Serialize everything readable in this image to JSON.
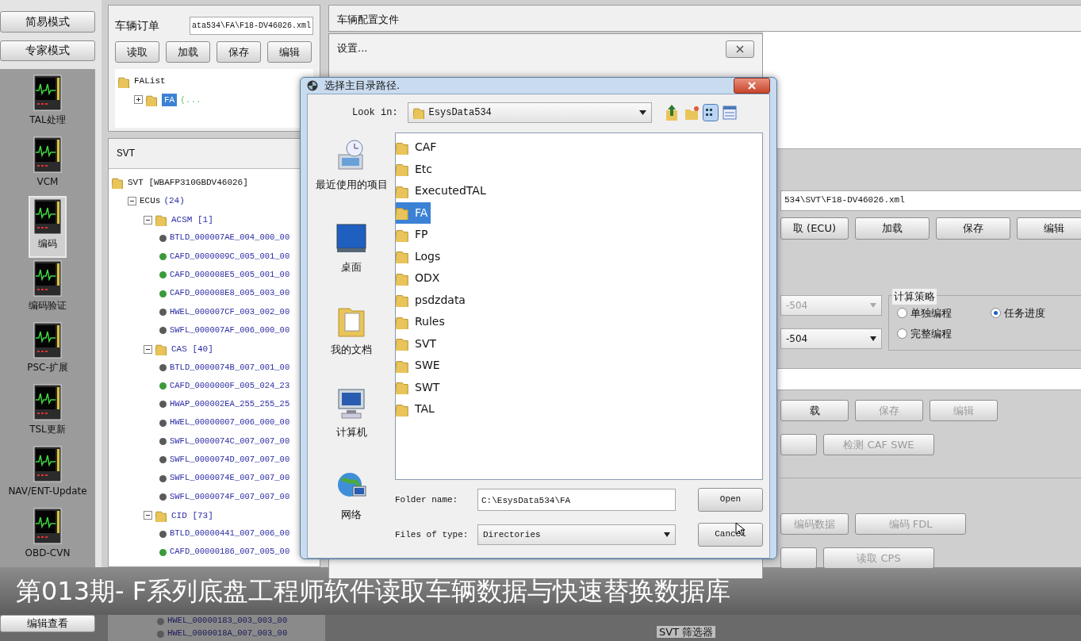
{
  "sidebar": {
    "mode_buttons": [
      {
        "label": "简易模式"
      },
      {
        "label": "专家模式"
      }
    ],
    "items": [
      {
        "label": "TAL处理",
        "selected": false
      },
      {
        "label": "VCM",
        "selected": false
      },
      {
        "label": "编码",
        "selected": true
      },
      {
        "label": "编码验证",
        "selected": false
      },
      {
        "label": "PSC-扩展",
        "selected": false
      },
      {
        "label": "TSL更新",
        "selected": false
      },
      {
        "label": "NAV/ENT-Update",
        "selected": false
      },
      {
        "label": "OBD-CVN",
        "selected": false
      }
    ],
    "bottom_button": "编辑查看"
  },
  "order_panel": {
    "title": "车辆订单",
    "path": "ata534\\FA\\F18-DV46026.xml",
    "buttons": [
      "读取",
      "加载",
      "保存",
      "编辑"
    ],
    "tree": [
      {
        "label": "FAList",
        "kind": "root",
        "selected": false,
        "children": [
          {
            "label": "FA",
            "kind": "folder",
            "expanded": false,
            "selected": true,
            "note": "(..."
          }
        ]
      }
    ]
  },
  "svt_panel": {
    "title": "SVT",
    "tree": [
      {
        "label": "SVT [WBAFP310GBDV46026]",
        "kind": "root",
        "children": [
          {
            "label": "ECUs",
            "count": "(24)",
            "kind": "group",
            "expanded": true,
            "children": [
              {
                "label": "ACSM [1]",
                "kind": "folder",
                "expanded": true,
                "children": [
                  {
                    "label": "BTLD_000007AE_004_000_00",
                    "kind": "leaf",
                    "color": "#5a5a5a"
                  },
                  {
                    "label": "CAFD_0000009C_005_001_00",
                    "kind": "leaf",
                    "color": "#3a9a3a"
                  },
                  {
                    "label": "CAFD_000008E5_005_001_00",
                    "kind": "leaf",
                    "color": "#3a9a3a"
                  },
                  {
                    "label": "CAFD_000008E8_005_003_00",
                    "kind": "leaf",
                    "color": "#3a9a3a"
                  },
                  {
                    "label": "HWEL_000007CF_003_002_00",
                    "kind": "leaf",
                    "color": "#5a5a5a"
                  },
                  {
                    "label": "SWFL_000007AF_006_000_00",
                    "kind": "leaf",
                    "color": "#5a5a5a"
                  }
                ]
              },
              {
                "label": "CAS [40]",
                "kind": "folder",
                "expanded": true,
                "children": [
                  {
                    "label": "BTLD_0000074B_007_001_00",
                    "kind": "leaf",
                    "color": "#5a5a5a"
                  },
                  {
                    "label": "CAFD_0000000F_005_024_23",
                    "kind": "leaf",
                    "color": "#3a9a3a"
                  },
                  {
                    "label": "HWAP_000002EA_255_255_25",
                    "kind": "leaf",
                    "color": "#5a5a5a"
                  },
                  {
                    "label": "HWEL_00000007_006_000_00",
                    "kind": "leaf",
                    "color": "#5a5a5a"
                  },
                  {
                    "label": "SWFL_0000074C_007_007_00",
                    "kind": "leaf",
                    "color": "#5a5a5a"
                  },
                  {
                    "label": "SWFL_0000074D_007_007_00",
                    "kind": "leaf",
                    "color": "#5a5a5a"
                  },
                  {
                    "label": "SWFL_0000074E_007_007_00",
                    "kind": "leaf",
                    "color": "#5a5a5a"
                  },
                  {
                    "label": "SWFL_0000074F_007_007_00",
                    "kind": "leaf",
                    "color": "#5a5a5a"
                  }
                ]
              },
              {
                "label": "CID [73]",
                "kind": "folder",
                "expanded": true,
                "children": [
                  {
                    "label": "BTLD_00000441_007_006_00",
                    "kind": "leaf",
                    "color": "#5a5a5a"
                  },
                  {
                    "label": "CAFD_00000186_007_005_00",
                    "kind": "leaf",
                    "color": "#3a9a3a"
                  }
                ]
              }
            ]
          }
        ]
      }
    ],
    "tree_continued": [
      {
        "label": "HWEL_00000183_003_003_00",
        "color": "#5a5a5a"
      },
      {
        "label": "HWEL_0000018A_007_003_00",
        "color": "#5a5a5a"
      }
    ]
  },
  "config_panel": {
    "title": "车辆配置文件",
    "settings_window": {
      "title": "设置..."
    },
    "path": "534\\SVT\\F18-DV46026.xml",
    "buttons": [
      "取 (ECU)",
      "加载",
      "保存",
      "编辑"
    ],
    "combos": [
      {
        "value": "-504",
        "disabled": true
      },
      {
        "value": "-504",
        "disabled": false
      }
    ],
    "strategy": {
      "title": "计算策略",
      "options": [
        {
          "label": "单独编程",
          "selected": false
        },
        {
          "label": "任务进度",
          "selected": true
        },
        {
          "label": "完整编程",
          "selected": false
        }
      ]
    },
    "button_groups": [
      {
        "rows": [
          [
            {
              "label": "载",
              "disabled": false
            },
            {
              "label": "保存",
              "disabled": true
            },
            {
              "label": "编辑",
              "disabled": true
            }
          ],
          [
            {},
            {
              "label": "检测 CAF SWE",
              "disabled": true
            }
          ]
        ]
      },
      {
        "rows": [
          [
            {
              "label": "编码数据",
              "disabled": true
            },
            {
              "label": "编码 FDL",
              "disabled": true
            }
          ],
          [
            {},
            {
              "label": "读取 CPS",
              "disabled": true
            }
          ]
        ]
      }
    ],
    "filter_title": "SVT 筛选器"
  },
  "dialog": {
    "title": "选择主目录路径.",
    "look_in_label": "Look in:",
    "look_in": "EsysData534",
    "places": [
      {
        "label": "最近使用的项目",
        "kind": "recent"
      },
      {
        "label": "桌面",
        "kind": "desktop"
      },
      {
        "label": "我的文档",
        "kind": "documents"
      },
      {
        "label": "计算机",
        "kind": "computer"
      },
      {
        "label": "网络",
        "kind": "network"
      }
    ],
    "folders": [
      {
        "name": "CAF",
        "selected": false
      },
      {
        "name": "Etc",
        "selected": false
      },
      {
        "name": "ExecutedTAL",
        "selected": false
      },
      {
        "name": "FA",
        "selected": true
      },
      {
        "name": "FP",
        "selected": false
      },
      {
        "name": "Logs",
        "selected": false
      },
      {
        "name": "ODX",
        "selected": false
      },
      {
        "name": "psdzdata",
        "selected": false
      },
      {
        "name": "Rules",
        "selected": false
      },
      {
        "name": "SVT",
        "selected": false
      },
      {
        "name": "SWE",
        "selected": false
      },
      {
        "name": "SWT",
        "selected": false
      },
      {
        "name": "TAL",
        "selected": false
      }
    ],
    "folder_name_label": "Folder name:",
    "folder_name": "C:\\EsysData534\\FA",
    "type_label": "Files of type:",
    "type": "Directories",
    "buttons": [
      "Open",
      "Cancel"
    ]
  },
  "caption": "第013期- F系列底盘工程师软件读取车辆数据与快速替换数据库"
}
